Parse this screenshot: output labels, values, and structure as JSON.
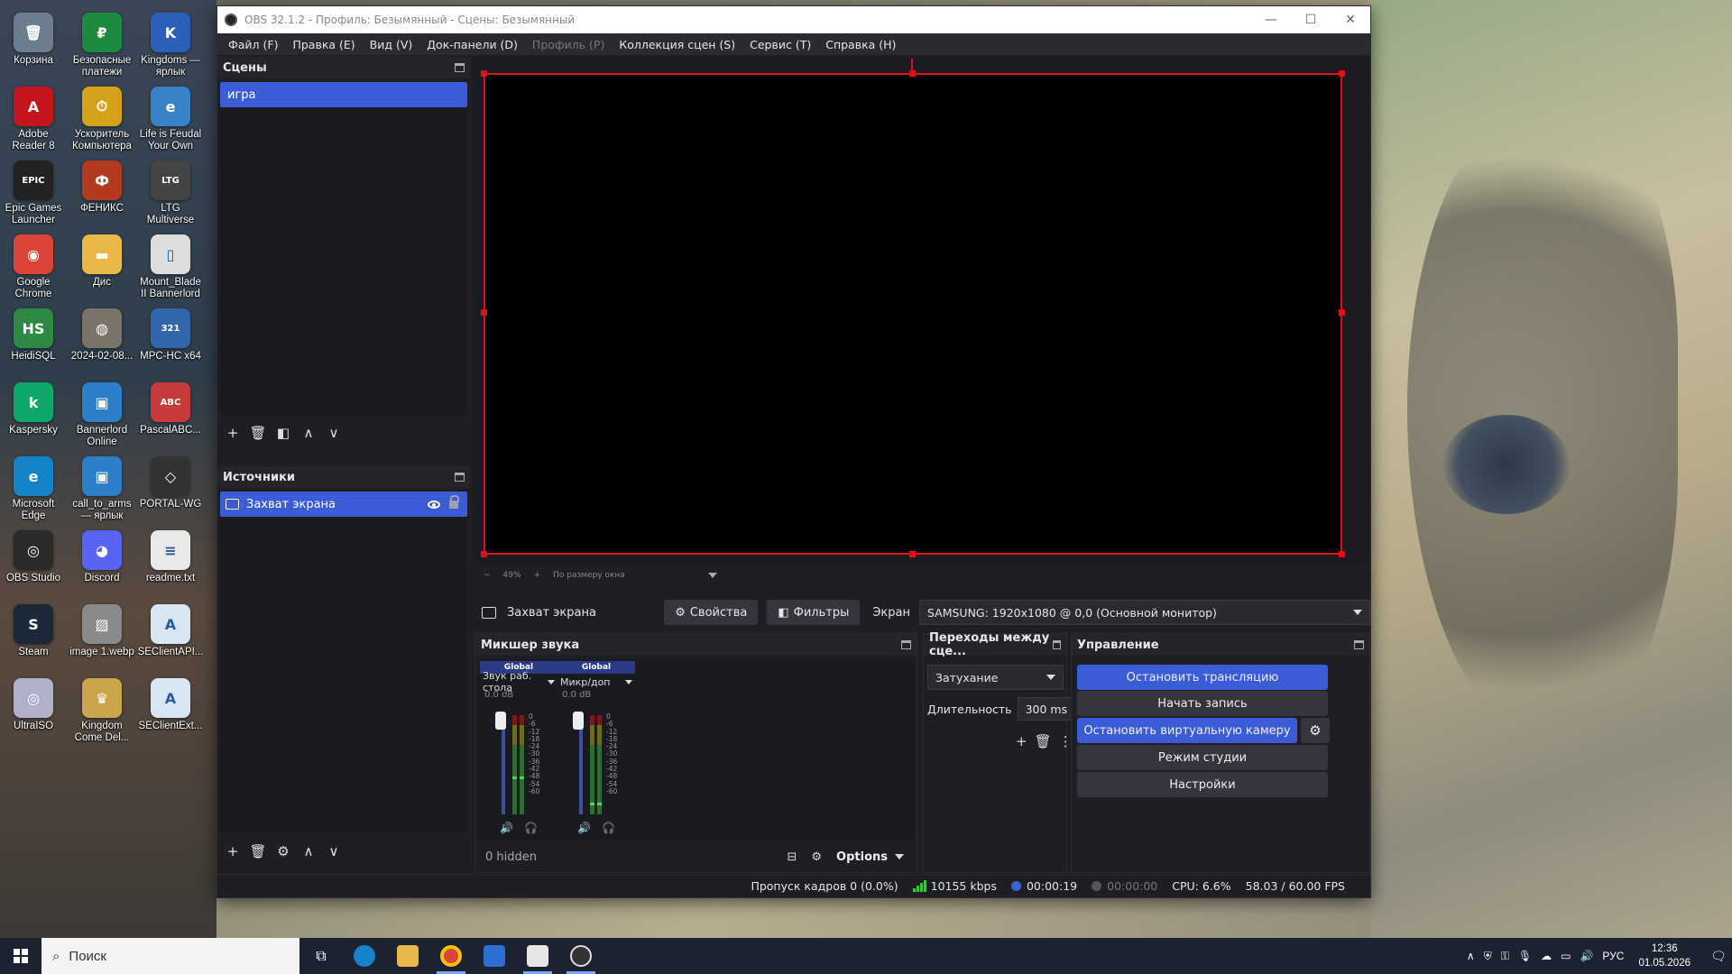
{
  "window": {
    "title": "OBS 32.1.2 - Профиль: Безымянный - Сцены: Безымянный"
  },
  "menu": [
    {
      "label": "Файл (F)",
      "enabled": true
    },
    {
      "label": "Правка (E)",
      "enabled": true
    },
    {
      "label": "Вид (V)",
      "enabled": true
    },
    {
      "label": "Док-панели (D)",
      "enabled": true
    },
    {
      "label": "Профиль (P)",
      "enabled": false
    },
    {
      "label": "Коллекция сцен (S)",
      "enabled": true
    },
    {
      "label": "Сервис (T)",
      "enabled": true
    },
    {
      "label": "Справка (H)",
      "enabled": true
    }
  ],
  "scenes": {
    "title": "Сцены",
    "items": [
      "игра"
    ]
  },
  "sources": {
    "title": "Источники",
    "items": [
      "Захват экрана"
    ]
  },
  "zoom": {
    "percent": "49%",
    "mode": "По размеру окна"
  },
  "source_bar": {
    "source": "Захват экрана",
    "properties": "Свойства",
    "filters": "Фильтры",
    "screen_label": "Экран",
    "screen_value": "SAMSUNG: 1920x1080 @ 0,0 (Основной монитор)"
  },
  "mixer": {
    "title": "Микшер звука",
    "channels": [
      {
        "tag": "Global",
        "name": "Звук раб. стола",
        "db": "0.0 dB",
        "level": 0.38
      },
      {
        "tag": "Global",
        "name": "Микр/доп",
        "db": "0.0 dB",
        "level": 0.12
      }
    ],
    "scale": [
      "0",
      "-6",
      "-12",
      "-18",
      "-24",
      "-30",
      "-36",
      "-42",
      "-48",
      "-54",
      "-60"
    ],
    "hidden": "0 hidden",
    "options": "Options"
  },
  "transitions": {
    "title": "Переходы между сце...",
    "selected": "Затухание",
    "duration_label": "Длительность",
    "duration_value": "300 ms"
  },
  "controls": {
    "title": "Управление",
    "stop_stream": "Остановить трансляцию",
    "start_record": "Начать запись",
    "stop_virtualcam": "Остановить виртуальную камеру",
    "studio_mode": "Режим студии",
    "settings": "Настройки"
  },
  "status": {
    "dropped": "Пропуск кадров 0 (0.0%)",
    "bitrate": "10155 kbps",
    "stream_time": "00:00:19",
    "record_time": "00:00:00",
    "cpu": "CPU: 6.6%",
    "fps": "58.03 / 60.00 FPS"
  },
  "desktop_icons": [
    {
      "label": "Корзина",
      "color": "#6b7d8f",
      "glyph": "🗑"
    },
    {
      "label": "Безопасные платежи",
      "color": "#1d8a3e",
      "glyph": "₽"
    },
    {
      "label": "Kingdoms — ярлык",
      "color": "#2b5fb8",
      "glyph": "K"
    },
    {
      "label": "Adobe Reader 8",
      "color": "#c4161c",
      "glyph": "A"
    },
    {
      "label": "Ускоритель Компьютера",
      "color": "#d6a21c",
      "glyph": "⏱"
    },
    {
      "label": "Life is Feudal Your Own",
      "color": "#3a82c8",
      "glyph": "e"
    },
    {
      "label": "Epic Games Launcher",
      "color": "#222222",
      "glyph": "EPIC"
    },
    {
      "label": "ФЕНИКС",
      "color": "#b33a1e",
      "glyph": "Ф"
    },
    {
      "label": "LTG Multiverse",
      "color": "#444444",
      "glyph": "LTG"
    },
    {
      "label": "Google Chrome",
      "color": "#db4437",
      "glyph": "◉"
    },
    {
      "label": "Дис",
      "color": "#e8b84a",
      "glyph": "▬"
    },
    {
      "label": "Mount_Blade II Bannerlord",
      "color": "#dddddd",
      "glyph": "▯"
    },
    {
      "label": "HeidiSQL",
      "color": "#2c8a43",
      "glyph": "HS"
    },
    {
      "label": "2024-02-08...",
      "color": "#7a7468",
      "glyph": "◍"
    },
    {
      "label": "MPC-HC x64",
      "color": "#3366aa",
      "glyph": "321"
    },
    {
      "label": "Kaspersky",
      "color": "#0ea86b",
      "glyph": "k"
    },
    {
      "label": "Bannerlord Online",
      "color": "#2d7fc9",
      "glyph": "▣"
    },
    {
      "label": "PascalABC...",
      "color": "#c63a3a",
      "glyph": "ABC"
    },
    {
      "label": "Microsoft Edge",
      "color": "#1483c9",
      "glyph": "e"
    },
    {
      "label": "call_to_arms — ярлык",
      "color": "#2d7fc9",
      "glyph": "▣"
    },
    {
      "label": "PORTAL-WG",
      "color": "#333333",
      "glyph": "◇"
    },
    {
      "label": "OBS Studio",
      "color": "#2a2a2a",
      "glyph": "◎"
    },
    {
      "label": "Discord",
      "color": "#5865f2",
      "glyph": "◕"
    },
    {
      "label": "readme.txt",
      "color": "#e9e9e9",
      "glyph": "≡"
    },
    {
      "label": "Steam",
      "color": "#1b2838",
      "glyph": "S"
    },
    {
      "label": "image 1.webp",
      "color": "#8a8a8a",
      "glyph": "▨"
    },
    {
      "label": "SEClientAPI...",
      "color": "#d8e6f3",
      "glyph": "A"
    },
    {
      "label": "UltraISO",
      "color": "#b0b0c8",
      "glyph": "◎"
    },
    {
      "label": "Kingdom Come Del...",
      "color": "#c9a64b",
      "glyph": "♛"
    },
    {
      "label": "SEClientExt...",
      "color": "#d8e6f3",
      "glyph": "A"
    }
  ],
  "taskbar": {
    "search_placeholder": "Поиск",
    "language": "РУС",
    "time": "12:36",
    "date": "01.05.2026"
  }
}
